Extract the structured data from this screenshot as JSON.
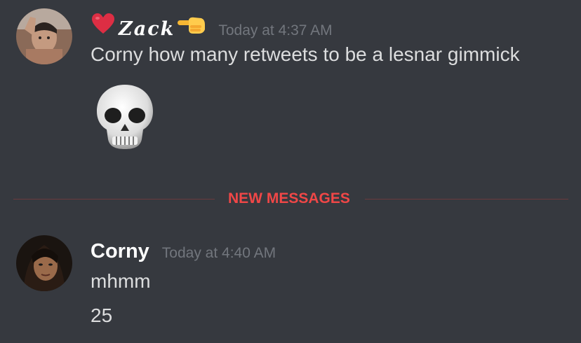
{
  "messages": [
    {
      "username": "Zack",
      "username_prefix_icon": "red-heart-icon",
      "username_suffix_icon": "pointing-left-hand-icon",
      "timestamp": "Today at 4:37 AM",
      "text": "Corny how many retweets to be a lesnar gimmick",
      "attachment_icon": "skull-emoji-icon"
    },
    {
      "username": "Corny",
      "timestamp": "Today at 4:40 AM",
      "lines": [
        "mhmm",
        "25"
      ]
    }
  ],
  "divider": {
    "label": "NEW MESSAGES",
    "color": "#f04747"
  },
  "colors": {
    "background": "#36393f",
    "username": "#ffffff",
    "message_text": "#dcddde",
    "timestamp": "#72767d"
  }
}
